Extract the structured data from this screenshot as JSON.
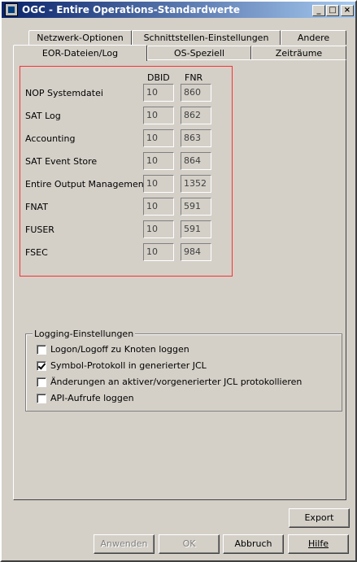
{
  "window": {
    "title": "OGC - Entire Operations-Standardwerte"
  },
  "tabs_back": [
    {
      "label": "Netzwerk-Optionen"
    },
    {
      "label": "Schnittstellen-Einstellungen"
    },
    {
      "label": "Andere"
    }
  ],
  "tabs_front": [
    {
      "label": "EOR-Dateien/Log",
      "active": true
    },
    {
      "label": "OS-Speziell"
    },
    {
      "label": "Zeiträume"
    }
  ],
  "table": {
    "headers": {
      "dbid": "DBID",
      "fnr": "FNR"
    },
    "rows": [
      {
        "label": "NOP Systemdatei",
        "dbid": "10",
        "fnr": "860"
      },
      {
        "label": "SAT Log",
        "dbid": "10",
        "fnr": "862"
      },
      {
        "label": "Accounting",
        "dbid": "10",
        "fnr": "863"
      },
      {
        "label": "SAT Event Store",
        "dbid": "10",
        "fnr": "864"
      },
      {
        "label": "Entire Output Management",
        "dbid": "10",
        "fnr": "1352"
      },
      {
        "label": "FNAT",
        "dbid": "10",
        "fnr": "591"
      },
      {
        "label": "FUSER",
        "dbid": "10",
        "fnr": "591"
      },
      {
        "label": "FSEC",
        "dbid": "10",
        "fnr": "984"
      }
    ]
  },
  "logging": {
    "title": "Logging-Einstellungen",
    "options": [
      {
        "label": "Logon/Logoff zu Knoten loggen",
        "checked": false
      },
      {
        "label": "Symbol-Protokoll in generierter JCL",
        "checked": true
      },
      {
        "label": "Änderungen an aktiver/vorgenerierter JCL protokollieren",
        "checked": false
      },
      {
        "label": "API-Aufrufe loggen",
        "checked": false
      }
    ]
  },
  "buttons": {
    "export": "Export",
    "apply": "Anwenden",
    "ok": "OK",
    "cancel": "Abbruch",
    "help": "Hilfe"
  }
}
